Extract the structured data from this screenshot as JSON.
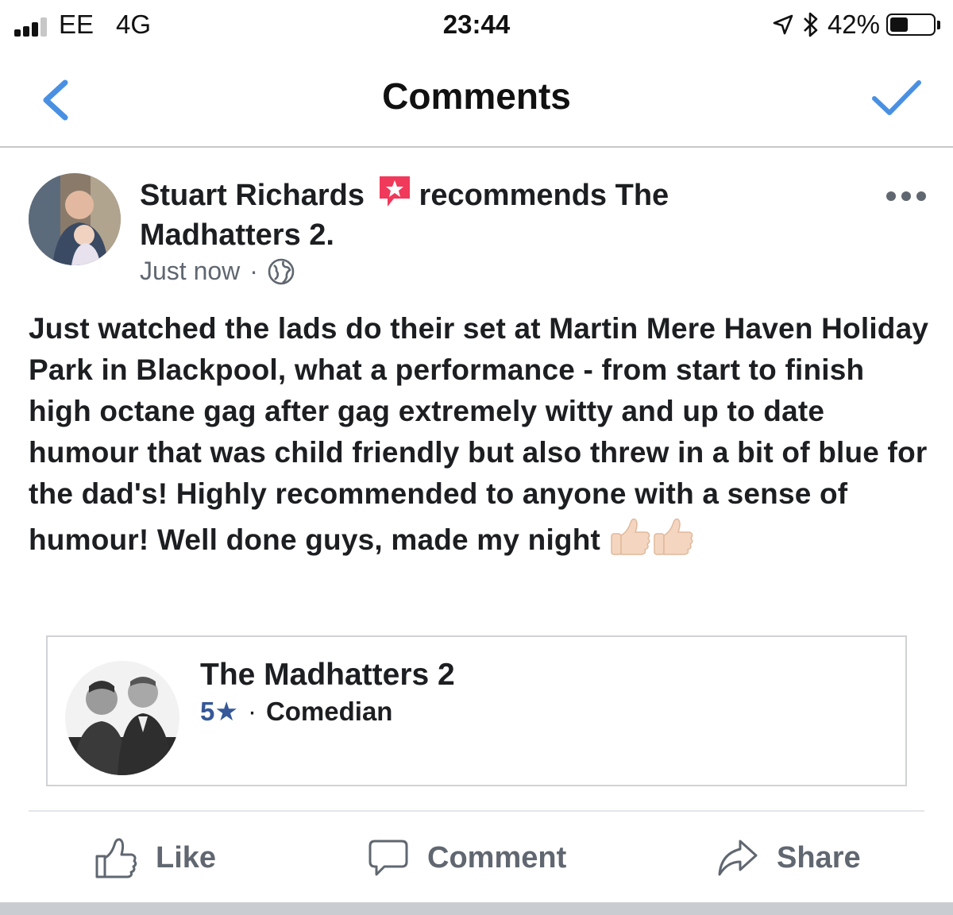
{
  "status_bar": {
    "carrier": "EE",
    "network": "4G",
    "time": "23:44",
    "battery": "42%",
    "battery_level": 0.42,
    "icons": [
      "signal-icon",
      "location-arrow-icon",
      "bluetooth-icon",
      "battery-icon"
    ]
  },
  "nav": {
    "title": "Comments",
    "back_icon": "chevron-left-icon",
    "done_icon": "checkmark-icon",
    "accent_color": "#4a90e2"
  },
  "post": {
    "author": "Stuart Richards",
    "recommends_text": "recommends The",
    "page_name": "Madhatters 2.",
    "recommend_icon": "recommendation-star-icon",
    "recommend_icon_color": "#f0395b",
    "timestamp": "Just now",
    "separator": "·",
    "privacy_icon": "globe-icon",
    "more_icon": "more-options-icon",
    "body": "Just watched the lads do their set at Martin Mere Haven Holiday Park in Blackpool, what a performance - from start to finish high octane gag after gag extremely witty and up to date humour that was child friendly but also threw in a bit of blue for the dad's! Highly recommended to anyone with a sense of humour! Well done guys, made my night",
    "emoji": "thumbs-up-icon"
  },
  "attachment": {
    "title": "The Madhatters 2",
    "rating": "5★",
    "separator": "·",
    "category": "Comedian",
    "rating_color": "#365899"
  },
  "actions": {
    "like": "Like",
    "comment": "Comment",
    "share": "Share",
    "color": "#606770"
  }
}
